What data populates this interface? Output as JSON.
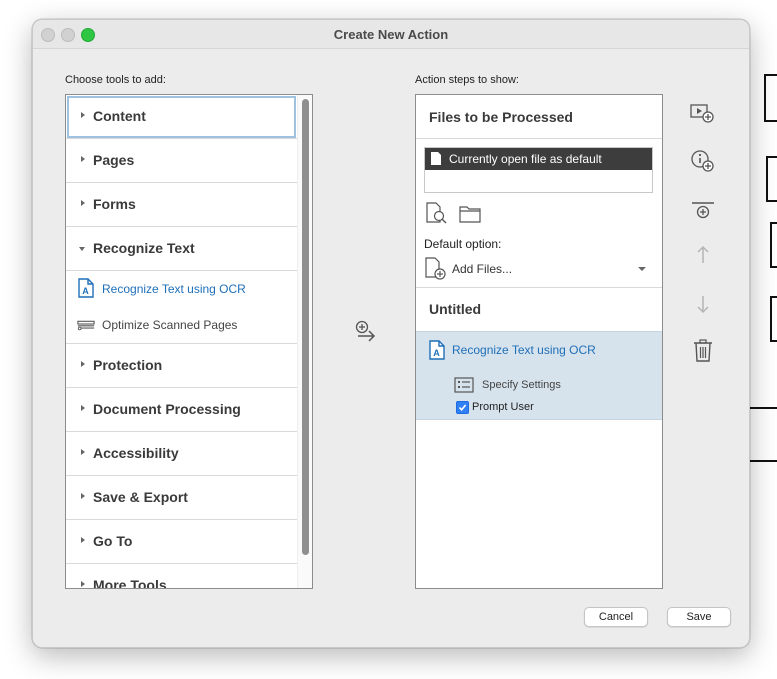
{
  "window": {
    "title": "Create New Action"
  },
  "left": {
    "heading": "Choose tools to add:",
    "categories_top": [
      {
        "label": "Content",
        "expanded": false,
        "focused": true
      },
      {
        "label": "Pages",
        "expanded": false
      },
      {
        "label": "Forms",
        "expanded": false
      },
      {
        "label": "Recognize Text",
        "expanded": true
      }
    ],
    "subtools": [
      {
        "label": "Recognize Text using OCR",
        "icon": "ocr-doc-icon"
      },
      {
        "label": "Optimize Scanned Pages",
        "icon": "scanner-icon"
      }
    ],
    "categories_bottom": [
      {
        "label": "Protection"
      },
      {
        "label": "Document Processing"
      },
      {
        "label": "Accessibility"
      },
      {
        "label": "Save & Export"
      },
      {
        "label": "Go To"
      },
      {
        "label": "More Tools"
      }
    ]
  },
  "right": {
    "heading": "Action steps to show:",
    "files_section": "Files to be Processed",
    "selected_file": "Currently open file as default",
    "default_option_label": "Default option:",
    "default_option_value": "Add Files...",
    "untitled": "Untitled",
    "step": {
      "label": "Recognize Text using OCR",
      "settings": "Specify Settings",
      "prompt_user": "Prompt User",
      "prompt_checked": true
    }
  },
  "buttons": {
    "cancel": "Cancel",
    "save": "Save"
  },
  "colors": {
    "accent": "#1f6fb8",
    "selection": "#d6e3ed",
    "maximize": "#2fc644"
  }
}
